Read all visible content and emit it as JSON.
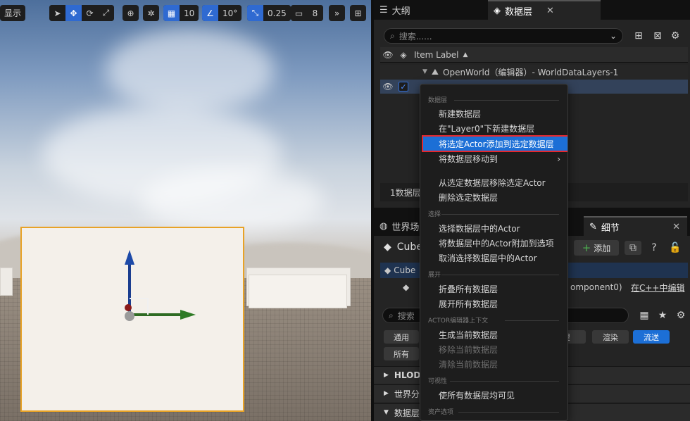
{
  "viewport": {
    "show_label": "显示",
    "grid_snap": "10",
    "angle_snap": "10°",
    "scale_snap": "0.25",
    "camera_speed": "8"
  },
  "outliner_tab": {
    "label": "大纲"
  },
  "data_layers_tab": {
    "label": "数据层"
  },
  "data_layers": {
    "search_placeholder": "搜索......",
    "column_header": "Item Label",
    "sort_indicator": "▲",
    "world_row": "OpenWorld（编辑器）- WorldDataLayers-1",
    "count_label": "1数据层"
  },
  "world_partition_tab": {
    "label": "世界场"
  },
  "details_tab": {
    "label": "细节"
  },
  "details": {
    "object_name": "Cube",
    "add_label": "添加",
    "component_root": "Cube",
    "component_child_suffix": "omponent0)",
    "cpp_link": "在C++中编辑",
    "search_placeholder": "搜索",
    "filters": {
      "general": "通用",
      "all": "所有",
      "physics_partial": "理",
      "render": "渲染",
      "streaming": "流送"
    },
    "sections": {
      "hlod": "HLOD",
      "world_partition": "世界分区",
      "data_layers": "数据层"
    }
  },
  "context_menu": {
    "headers": {
      "data_layer": "数据层",
      "selection": "选择",
      "expand": "展开",
      "actor_editor_context": "ACTOR编辑器上下文",
      "visibility": "可视性",
      "asset_options": "资产选项"
    },
    "items": {
      "new_layer": "新建数据层",
      "new_under": "在\"Layer0\"下新建数据层",
      "add_selected": "将选定Actor添加到选定数据层",
      "move_to": "将数据层移动到",
      "remove_selected": "从选定数据层移除选定Actor",
      "delete_selected": "删除选定数据层",
      "select_actors": "选择数据层中的Actor",
      "append_actors": "将数据层中的Actor附加到选项",
      "deselect_actors": "取消选择数据层中的Actor",
      "collapse_all": "折叠所有数据层",
      "expand_all": "展开所有数据层",
      "make_current": "生成当前数据层",
      "remove_current": "移除当前数据层",
      "clear_current": "清除当前数据层",
      "make_all_visible": "使所有数据层均可见"
    }
  },
  "colors": {
    "accent": "#1c6fd6",
    "highlight_border": "#e5282e",
    "selection_outline": "#e8a226"
  }
}
